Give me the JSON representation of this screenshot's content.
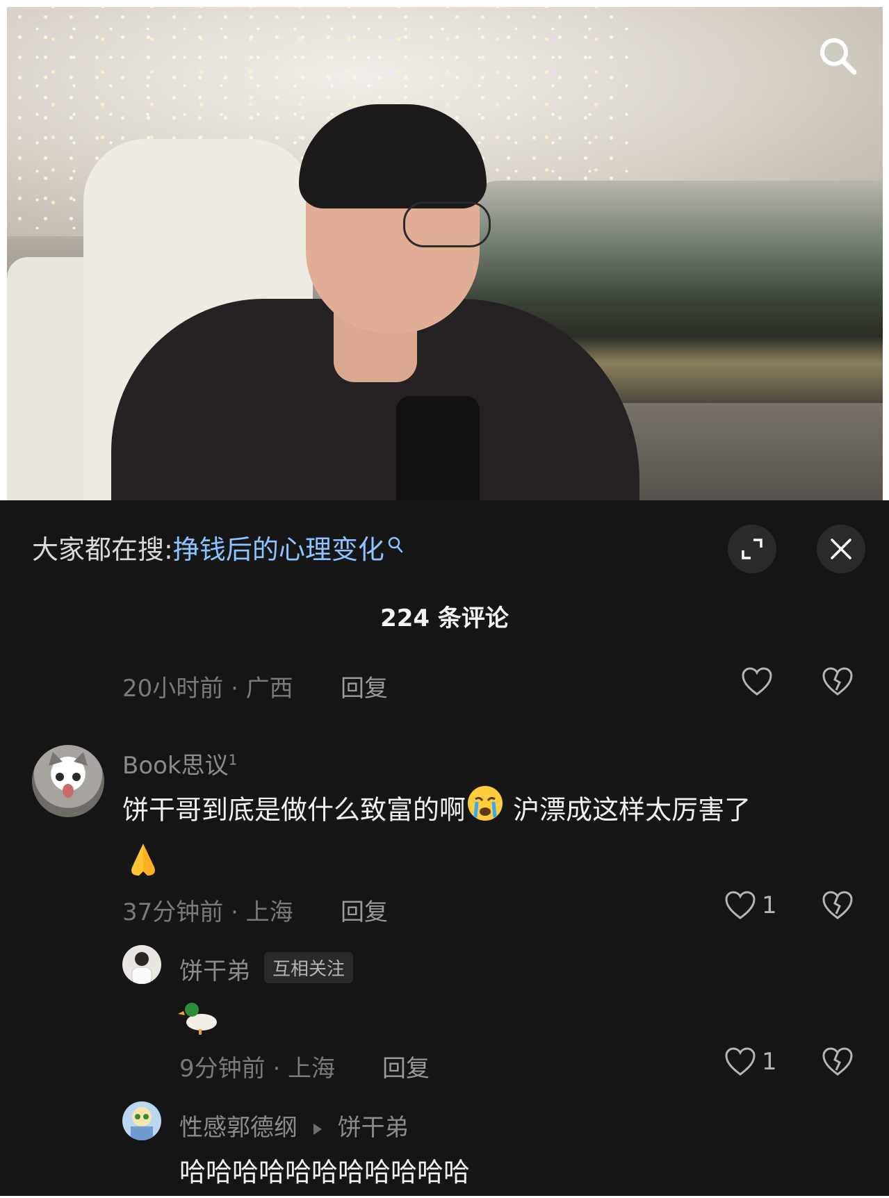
{
  "search_bar": {
    "prefix": "大家都在搜:",
    "term": "挣钱后的心理变化"
  },
  "comment_count": "224 条评论",
  "comments": [
    {
      "meta": "20小时前 · 广西",
      "reply_label": "回复"
    },
    {
      "username": "Book思议",
      "superscript": "1",
      "text_line1": "饼干哥到底是做什么致富的啊",
      "text_line1b": "沪漂成这样太厉害了",
      "meta": "37分钟前 · 上海",
      "reply_label": "回复",
      "likes": "1",
      "replies": [
        {
          "username": "饼干弟",
          "badge": "互相关注",
          "meta": "9分钟前 · 上海",
          "reply_label": "回复",
          "likes": "1"
        },
        {
          "username": "性感郭德纲",
          "reply_to": "饼干弟",
          "text": "哈哈哈哈哈哈哈哈哈哈哈"
        }
      ]
    }
  ],
  "colors": {
    "panel_bg": "#161617",
    "accent_link": "#8cc4ff"
  },
  "icons": [
    "search-icon",
    "expand-icon",
    "close-icon",
    "heart-icon",
    "broken-heart-icon",
    "crying-emoji-icon",
    "folded-hands-emoji-icon",
    "duck-emoji-icon"
  ]
}
